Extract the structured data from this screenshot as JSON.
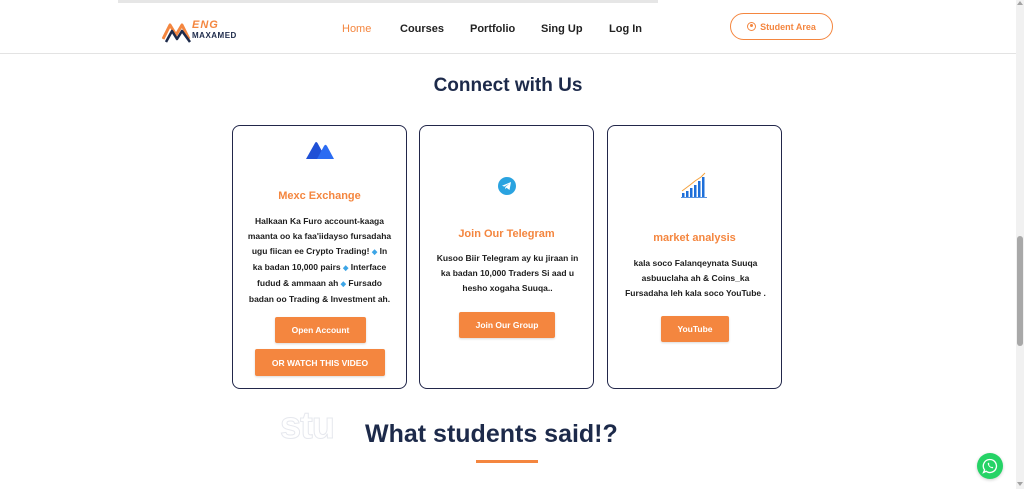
{
  "brand": {
    "logo_top": "ENG",
    "logo_bottom": "MAXAMED",
    "accent": "#f4863f",
    "navy": "#1d2a4a"
  },
  "nav": {
    "items": [
      {
        "label": "Home",
        "active": true
      },
      {
        "label": "Courses"
      },
      {
        "label": "Portfolio"
      },
      {
        "label": "Sing Up"
      },
      {
        "label": "Log In"
      }
    ],
    "student_area": "Student Area"
  },
  "connect": {
    "heading": "Connect with Us",
    "cards": [
      {
        "icon": "mexc-logo-icon",
        "title": "Mexc Exchange",
        "desc": [
          "Halkaan Ka Furo account-kaaga",
          "maanta oo ka faa'iidayso fursadaha",
          "ugu fiican ee Crypto Trading!",
          "In",
          "ka badan 10,000 pairs",
          "Interface",
          "fudud & ammaan ah",
          "Fursado",
          "badan oo Trading & Investment ah."
        ],
        "buttons": [
          "Open Account",
          "OR WATCH THIS VIDEO"
        ]
      },
      {
        "icon": "telegram-icon",
        "title": "Join Our Telegram",
        "desc": [
          "Kusoo Biir Telegram ay ku jiraan in",
          "ka badan 10,000 Traders Si aad u",
          "hesho xogaha Suuqa.."
        ],
        "buttons": [
          "Join Our Group"
        ]
      },
      {
        "icon": "growth-chart-icon",
        "title": "market analysis",
        "desc": [
          "kala soco Falanqeynata Suuqa",
          "asbuuclaha ah & Coins_ka",
          "Fursadaha leh kala soco YouTube ."
        ],
        "buttons": [
          "YouTube"
        ]
      }
    ]
  },
  "testimonials": {
    "ghost_text": "stu",
    "heading": "What students said!?"
  }
}
